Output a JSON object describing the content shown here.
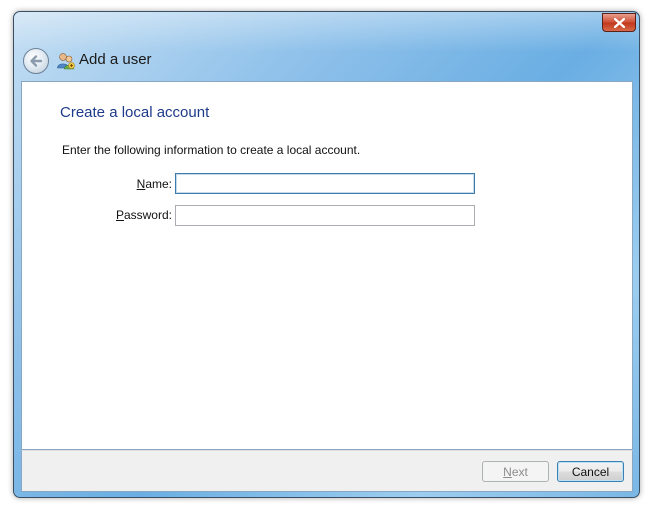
{
  "window": {
    "title": "Add a user",
    "close_label": "Close",
    "back_label": "Back"
  },
  "page": {
    "heading": "Create a local account",
    "instructions": "Enter the following information to create a local account."
  },
  "form": {
    "name": {
      "label_mnemonic": "N",
      "label_rest": "ame:",
      "value": "",
      "placeholder": ""
    },
    "password": {
      "label_mnemonic": "P",
      "label_rest": "assword:",
      "value": "",
      "placeholder": ""
    }
  },
  "footer": {
    "next": {
      "mnemonic": "N",
      "rest": "ext",
      "enabled": false
    },
    "cancel": {
      "label": "Cancel"
    }
  },
  "icons": {
    "close": "close-icon",
    "back": "back-arrow-icon",
    "app": "users-icon"
  },
  "colors": {
    "accent": "#1e3a8a",
    "close_button": "#c2391d",
    "frame": "#6aaee3"
  }
}
